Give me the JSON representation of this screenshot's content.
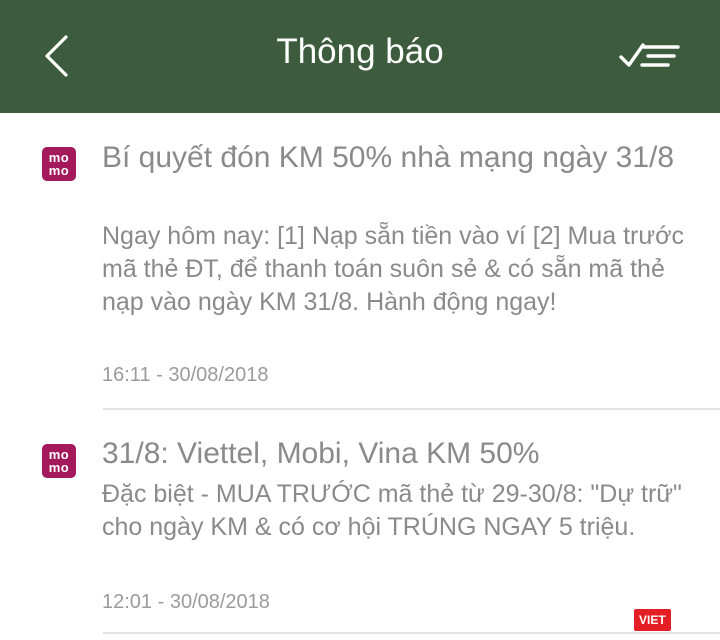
{
  "header": {
    "title": "Thông báo",
    "back_icon": "chevron-left-icon",
    "mark_all_icon": "checklist-icon",
    "background": "#3d5c3e"
  },
  "notifications": [
    {
      "logo_top": "mo",
      "logo_bottom": "mo",
      "title": "Bí quyết đón KM 50% nhà mạng ngày 31/8",
      "body": "Ngay hôm nay: [1] Nạp sẵn tiền vào ví [2] Mua trước mã thẻ ĐT, để thanh toán suôn sẻ & có sẵn mã thẻ nạp vào ngày KM 31/8. Hành động ngay!",
      "time": "16:11 - 30/08/2018"
    },
    {
      "logo_top": "mo",
      "logo_bottom": "mo",
      "title": "31/8: Viettel, Mobi, Vina KM 50%",
      "body": "Đặc biệt - MUA TRƯỚC mã thẻ từ 29-30/8: \"Dự trữ\" cho ngày KM & có cơ hội TRÚNG NGAY 5 triệu.",
      "time": "12:01 - 30/08/2018"
    }
  ],
  "watermark": "VIET",
  "colors": {
    "logo": "#a3195b",
    "text": "#8a8a8a"
  }
}
